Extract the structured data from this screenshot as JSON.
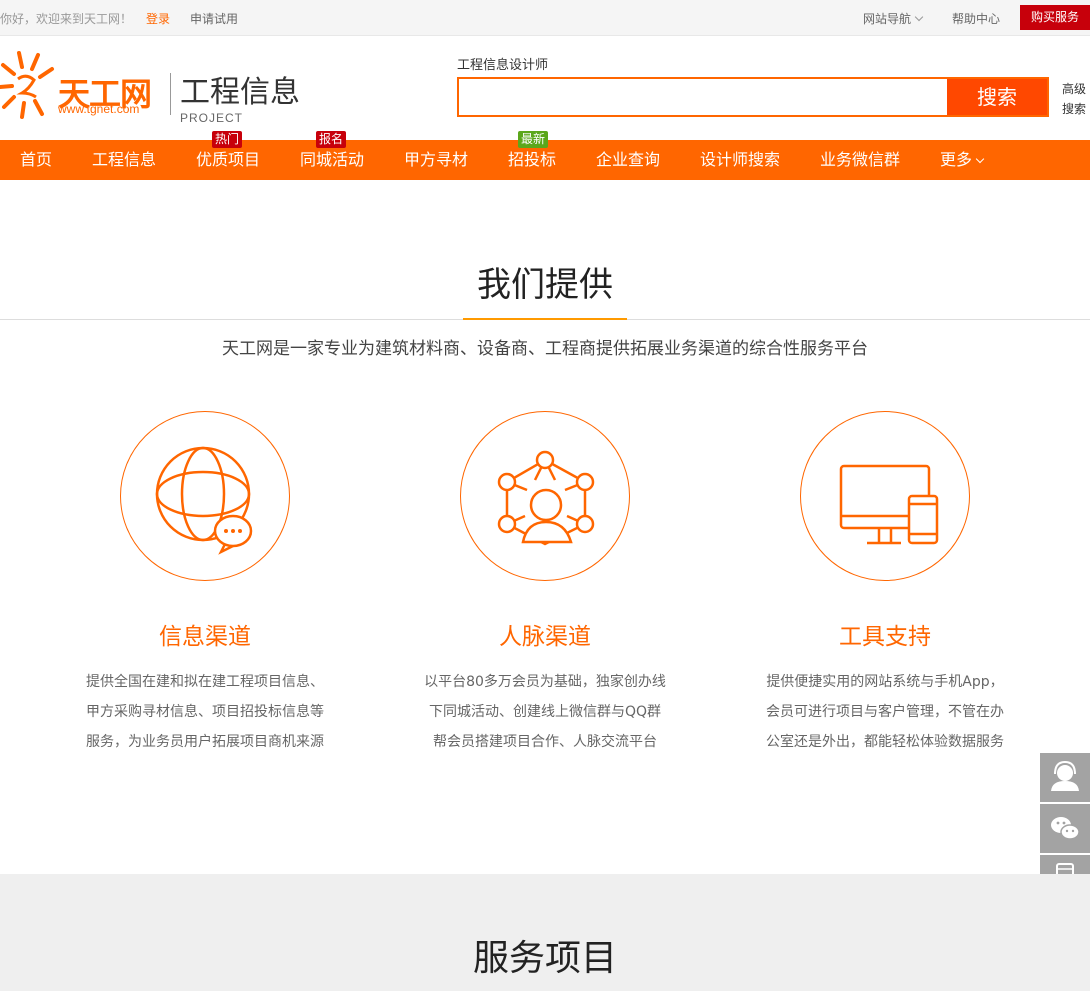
{
  "topbar": {
    "greeting": "你好，欢迎来到天工网！",
    "login": "登录",
    "trial": "申请试用",
    "site_nav": "网站导航",
    "help": "帮助中心",
    "buy": "购买服务"
  },
  "logo": {
    "brand": "天工网",
    "url": "www.tgnet.com",
    "product": "工程信息",
    "product_en": "PROJECT"
  },
  "search": {
    "hint": "工程信息设计师",
    "placeholder": "",
    "button": "搜索",
    "advanced": "高级搜索"
  },
  "nav": {
    "items": [
      {
        "label": "首页"
      },
      {
        "label": "工程信息"
      },
      {
        "label": "优质项目",
        "tag": "热门"
      },
      {
        "label": "同城活动",
        "tag": "报名"
      },
      {
        "label": "甲方寻材"
      },
      {
        "label": "招投标",
        "tag": "最新"
      },
      {
        "label": "企业查询"
      },
      {
        "label": "设计师搜索"
      },
      {
        "label": "业务微信群"
      },
      {
        "label": "更多"
      }
    ]
  },
  "offer": {
    "title": "我们提供",
    "subtitle": "天工网是一家专业为建筑材料商、设备商、工程商提供拓展业务渠道的综合性服务平台",
    "features": [
      {
        "icon": "globe-chat-icon",
        "title": "信息渠道",
        "lines": [
          "提供全国在建和拟在建工程项目信息、",
          "甲方采购寻材信息、项目招投标信息等",
          "服务，为业务员用户拓展项目商机来源"
        ]
      },
      {
        "icon": "network-people-icon",
        "title": "人脉渠道",
        "lines": [
          "以平台80多万会员为基础，独家创办线",
          "下同城活动、创建线上微信群与QQ群",
          "帮会员搭建项目合作、人脉交流平台"
        ]
      },
      {
        "icon": "devices-icon",
        "title": "工具支持",
        "lines": [
          "提供便捷实用的网站系统与手机App，",
          "会员可进行项目与客户管理，不管在办",
          "公室还是外出，都能轻松体验数据服务"
        ]
      }
    ]
  },
  "side_tools": [
    "customer-service-icon",
    "wechat-icon",
    "mobile-icon"
  ],
  "services": {
    "title": "服务项目"
  },
  "colors": {
    "accent": "#ff6600",
    "search_button": "#ff4800",
    "buy_button": "#c7000b",
    "tag_hot": "#c7000b",
    "tag_new": "#5ba71b",
    "side_tool": "#a3a3a3"
  }
}
